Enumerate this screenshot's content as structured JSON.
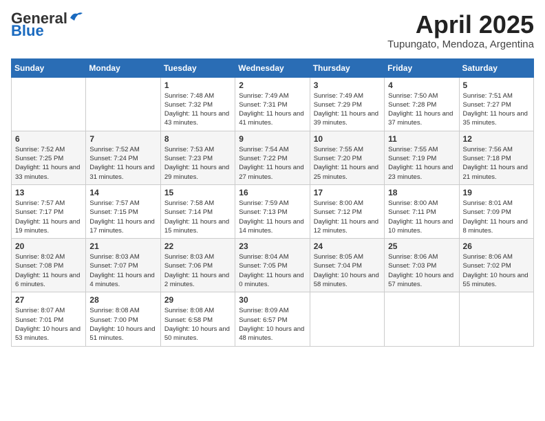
{
  "logo": {
    "general": "General",
    "blue": "Blue"
  },
  "title": {
    "month": "April 2025",
    "location": "Tupungato, Mendoza, Argentina"
  },
  "weekdays": [
    "Sunday",
    "Monday",
    "Tuesday",
    "Wednesday",
    "Thursday",
    "Friday",
    "Saturday"
  ],
  "weeks": [
    [
      {
        "day": null
      },
      {
        "day": null
      },
      {
        "day": "1",
        "sunrise": "Sunrise: 7:48 AM",
        "sunset": "Sunset: 7:32 PM",
        "daylight": "Daylight: 11 hours and 43 minutes."
      },
      {
        "day": "2",
        "sunrise": "Sunrise: 7:49 AM",
        "sunset": "Sunset: 7:31 PM",
        "daylight": "Daylight: 11 hours and 41 minutes."
      },
      {
        "day": "3",
        "sunrise": "Sunrise: 7:49 AM",
        "sunset": "Sunset: 7:29 PM",
        "daylight": "Daylight: 11 hours and 39 minutes."
      },
      {
        "day": "4",
        "sunrise": "Sunrise: 7:50 AM",
        "sunset": "Sunset: 7:28 PM",
        "daylight": "Daylight: 11 hours and 37 minutes."
      },
      {
        "day": "5",
        "sunrise": "Sunrise: 7:51 AM",
        "sunset": "Sunset: 7:27 PM",
        "daylight": "Daylight: 11 hours and 35 minutes."
      }
    ],
    [
      {
        "day": "6",
        "sunrise": "Sunrise: 7:52 AM",
        "sunset": "Sunset: 7:25 PM",
        "daylight": "Daylight: 11 hours and 33 minutes."
      },
      {
        "day": "7",
        "sunrise": "Sunrise: 7:52 AM",
        "sunset": "Sunset: 7:24 PM",
        "daylight": "Daylight: 11 hours and 31 minutes."
      },
      {
        "day": "8",
        "sunrise": "Sunrise: 7:53 AM",
        "sunset": "Sunset: 7:23 PM",
        "daylight": "Daylight: 11 hours and 29 minutes."
      },
      {
        "day": "9",
        "sunrise": "Sunrise: 7:54 AM",
        "sunset": "Sunset: 7:22 PM",
        "daylight": "Daylight: 11 hours and 27 minutes."
      },
      {
        "day": "10",
        "sunrise": "Sunrise: 7:55 AM",
        "sunset": "Sunset: 7:20 PM",
        "daylight": "Daylight: 11 hours and 25 minutes."
      },
      {
        "day": "11",
        "sunrise": "Sunrise: 7:55 AM",
        "sunset": "Sunset: 7:19 PM",
        "daylight": "Daylight: 11 hours and 23 minutes."
      },
      {
        "day": "12",
        "sunrise": "Sunrise: 7:56 AM",
        "sunset": "Sunset: 7:18 PM",
        "daylight": "Daylight: 11 hours and 21 minutes."
      }
    ],
    [
      {
        "day": "13",
        "sunrise": "Sunrise: 7:57 AM",
        "sunset": "Sunset: 7:17 PM",
        "daylight": "Daylight: 11 hours and 19 minutes."
      },
      {
        "day": "14",
        "sunrise": "Sunrise: 7:57 AM",
        "sunset": "Sunset: 7:15 PM",
        "daylight": "Daylight: 11 hours and 17 minutes."
      },
      {
        "day": "15",
        "sunrise": "Sunrise: 7:58 AM",
        "sunset": "Sunset: 7:14 PM",
        "daylight": "Daylight: 11 hours and 15 minutes."
      },
      {
        "day": "16",
        "sunrise": "Sunrise: 7:59 AM",
        "sunset": "Sunset: 7:13 PM",
        "daylight": "Daylight: 11 hours and 14 minutes."
      },
      {
        "day": "17",
        "sunrise": "Sunrise: 8:00 AM",
        "sunset": "Sunset: 7:12 PM",
        "daylight": "Daylight: 11 hours and 12 minutes."
      },
      {
        "day": "18",
        "sunrise": "Sunrise: 8:00 AM",
        "sunset": "Sunset: 7:11 PM",
        "daylight": "Daylight: 11 hours and 10 minutes."
      },
      {
        "day": "19",
        "sunrise": "Sunrise: 8:01 AM",
        "sunset": "Sunset: 7:09 PM",
        "daylight": "Daylight: 11 hours and 8 minutes."
      }
    ],
    [
      {
        "day": "20",
        "sunrise": "Sunrise: 8:02 AM",
        "sunset": "Sunset: 7:08 PM",
        "daylight": "Daylight: 11 hours and 6 minutes."
      },
      {
        "day": "21",
        "sunrise": "Sunrise: 8:03 AM",
        "sunset": "Sunset: 7:07 PM",
        "daylight": "Daylight: 11 hours and 4 minutes."
      },
      {
        "day": "22",
        "sunrise": "Sunrise: 8:03 AM",
        "sunset": "Sunset: 7:06 PM",
        "daylight": "Daylight: 11 hours and 2 minutes."
      },
      {
        "day": "23",
        "sunrise": "Sunrise: 8:04 AM",
        "sunset": "Sunset: 7:05 PM",
        "daylight": "Daylight: 11 hours and 0 minutes."
      },
      {
        "day": "24",
        "sunrise": "Sunrise: 8:05 AM",
        "sunset": "Sunset: 7:04 PM",
        "daylight": "Daylight: 10 hours and 58 minutes."
      },
      {
        "day": "25",
        "sunrise": "Sunrise: 8:06 AM",
        "sunset": "Sunset: 7:03 PM",
        "daylight": "Daylight: 10 hours and 57 minutes."
      },
      {
        "day": "26",
        "sunrise": "Sunrise: 8:06 AM",
        "sunset": "Sunset: 7:02 PM",
        "daylight": "Daylight: 10 hours and 55 minutes."
      }
    ],
    [
      {
        "day": "27",
        "sunrise": "Sunrise: 8:07 AM",
        "sunset": "Sunset: 7:01 PM",
        "daylight": "Daylight: 10 hours and 53 minutes."
      },
      {
        "day": "28",
        "sunrise": "Sunrise: 8:08 AM",
        "sunset": "Sunset: 7:00 PM",
        "daylight": "Daylight: 10 hours and 51 minutes."
      },
      {
        "day": "29",
        "sunrise": "Sunrise: 8:08 AM",
        "sunset": "Sunset: 6:58 PM",
        "daylight": "Daylight: 10 hours and 50 minutes."
      },
      {
        "day": "30",
        "sunrise": "Sunrise: 8:09 AM",
        "sunset": "Sunset: 6:57 PM",
        "daylight": "Daylight: 10 hours and 48 minutes."
      },
      {
        "day": null
      },
      {
        "day": null
      },
      {
        "day": null
      }
    ]
  ]
}
